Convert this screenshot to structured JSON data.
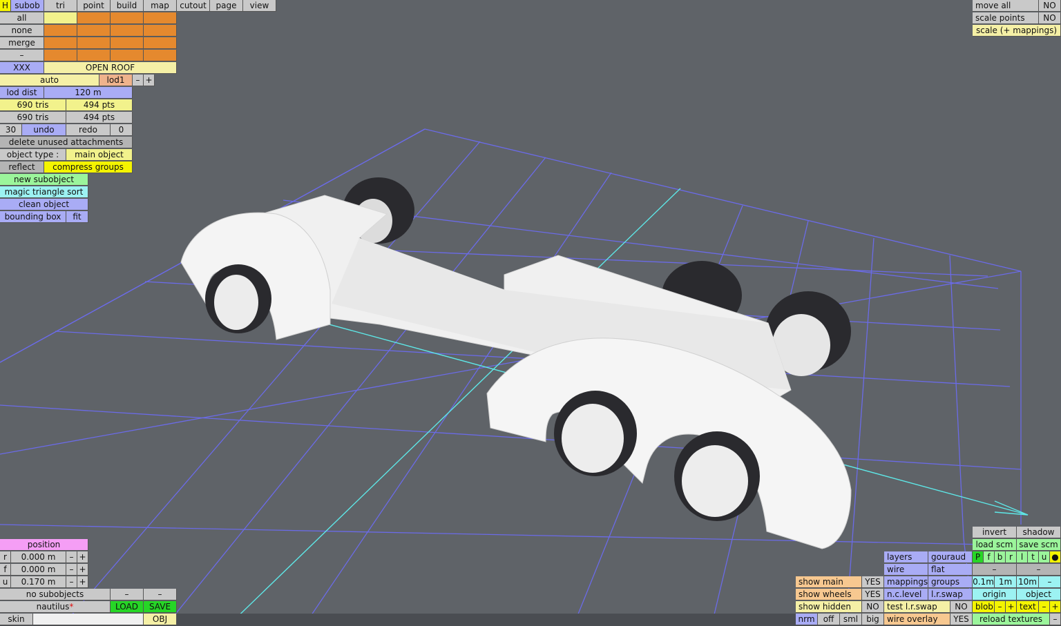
{
  "toolbar": {
    "h": "H",
    "tabs": [
      "subob",
      "tri",
      "point",
      "build",
      "map",
      "cutout",
      "page",
      "view"
    ]
  },
  "selection": {
    "all": "all",
    "none": "none",
    "merge": "merge",
    "dash": "–",
    "xxx": "XXX",
    "subobject_name": "OPEN ROOF"
  },
  "lod": {
    "auto": "auto",
    "level": "lod1",
    "minus": "–",
    "plus": "+",
    "dist_label": "lod dist",
    "dist_value": "120 m"
  },
  "stats": {
    "tris_a": "690 tris",
    "pts_a": "494 pts",
    "tris_b": "690 tris",
    "pts_b": "494 pts"
  },
  "history": {
    "count": "30",
    "undo": "undo",
    "redo": "redo",
    "redo_count": "0"
  },
  "actions": {
    "delete_unused": "delete unused attachments",
    "object_type_label": "object type :",
    "object_type_value": "main object",
    "reflect": "reflect",
    "compress_groups": "compress groups",
    "new_subobject": "new subobject",
    "magic_sort": "magic triangle sort",
    "clean_object": "clean object",
    "bounding_box": "bounding box",
    "fit": "fit"
  },
  "top_right": {
    "move_all": "move all",
    "move_all_val": "NO",
    "scale_points": "scale points",
    "scale_points_val": "NO",
    "scale_mappings": "scale (+ mappings)"
  },
  "position": {
    "title": "position",
    "rows": [
      {
        "axis": "r",
        "value": "0.000 m"
      },
      {
        "axis": "f",
        "value": "0.000 m"
      },
      {
        "axis": "u",
        "value": "0.170 m"
      }
    ],
    "minus": "–",
    "plus": "+"
  },
  "file": {
    "no_subobjects": "no subobjects",
    "dash": "–",
    "name": "nautilus",
    "modified_mark": "*",
    "load": "LOAD",
    "save": "SAVE",
    "skin": "skin",
    "obj": "OBJ"
  },
  "render_panel": {
    "invert": "invert",
    "shadow": "shadow",
    "load_scm": "load scm",
    "save_scm": "save scm",
    "layers": "layers",
    "gouraud": "gouraud",
    "view_letters": [
      "P",
      "f",
      "b",
      "r",
      "l",
      "t",
      "u",
      "●"
    ],
    "wire": "wire",
    "flat": "flat",
    "dash": "–",
    "show_main": "show main",
    "show_main_val": "YES",
    "mappings": "mappings",
    "groups": "groups",
    "grid_01": "0.1m",
    "grid_1": "1m",
    "grid_10": "10m",
    "show_wheels": "show wheels",
    "show_wheels_val": "YES",
    "nc_level": "n.c.level",
    "lr_swap": "l.r.swap",
    "origin": "origin",
    "object": "object",
    "show_hidden": "show hidden",
    "show_hidden_val": "NO",
    "test_lr_swap": "test l.r.swap",
    "test_lr_swap_val": "NO",
    "blob": "blob",
    "text": "text",
    "minus": "–",
    "plus": "+",
    "nrm": "nrm",
    "off": "off",
    "sml": "sml",
    "big": "big",
    "wire_overlay": "wire overlay",
    "wire_overlay_val": "YES",
    "reload_textures": "reload textures"
  },
  "colors": {
    "background": "#5f6368",
    "grid": "#6f6fe6",
    "axis": "#5ee8e8",
    "body": "#f4f4f4",
    "tyre": "#2a2a2e"
  }
}
